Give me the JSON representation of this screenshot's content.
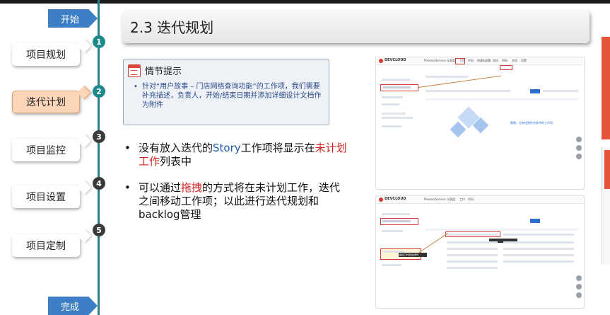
{
  "title": "2.3 迭代规划",
  "nav": {
    "start": "开始",
    "end": "完成",
    "steps": [
      {
        "num": "1",
        "label": "项目规划",
        "active": false
      },
      {
        "num": "2",
        "label": "迭代计划",
        "active": true
      },
      {
        "num": "3",
        "label": "项目监控",
        "active": false
      },
      {
        "num": "4",
        "label": "项目设置",
        "active": false
      },
      {
        "num": "5",
        "label": "项目定制",
        "active": false
      }
    ]
  },
  "tip": {
    "icon": "calendar-icon",
    "title": "情节提示",
    "bullet": "•",
    "text": "针对“用户故事 – 门店网络查询功能”的工作项，我们需要补充描述，负责人，开始/结束日期并添加详细设计文档作为附件"
  },
  "bullets": [
    {
      "dot": "•",
      "p1": "没有放入迭代的",
      "p2": "Story",
      "p3": "工作项将显示在",
      "p4": "未计划工作",
      "p5": "列表中"
    },
    {
      "dot": "•",
      "p1": "可以通过",
      "p2": "拖拽",
      "p3": "的方式将在未计划工作，迭代之间移动工作项；以此进行迭代规划和backlog管理"
    }
  ],
  "screens": {
    "logo_text": "DEVCLOUD",
    "nav_items": [
      "PhoenixService",
      "仪表盘",
      "工作",
      "代码",
      "构建&部署",
      "测试",
      "Wiki",
      "文档",
      "设置"
    ],
    "empty_hint": "哦哦，没有找到符合条件的工作项",
    "drag_hint": "拖拽工作项到此迭代"
  },
  "colors": {
    "accent_blue": "#3d7fc4",
    "timeline_teal": "#1e8a8a",
    "active_step": "#fdd5b9",
    "highlight_red": "#d42020",
    "highlight_blue": "#1e5aa8"
  }
}
